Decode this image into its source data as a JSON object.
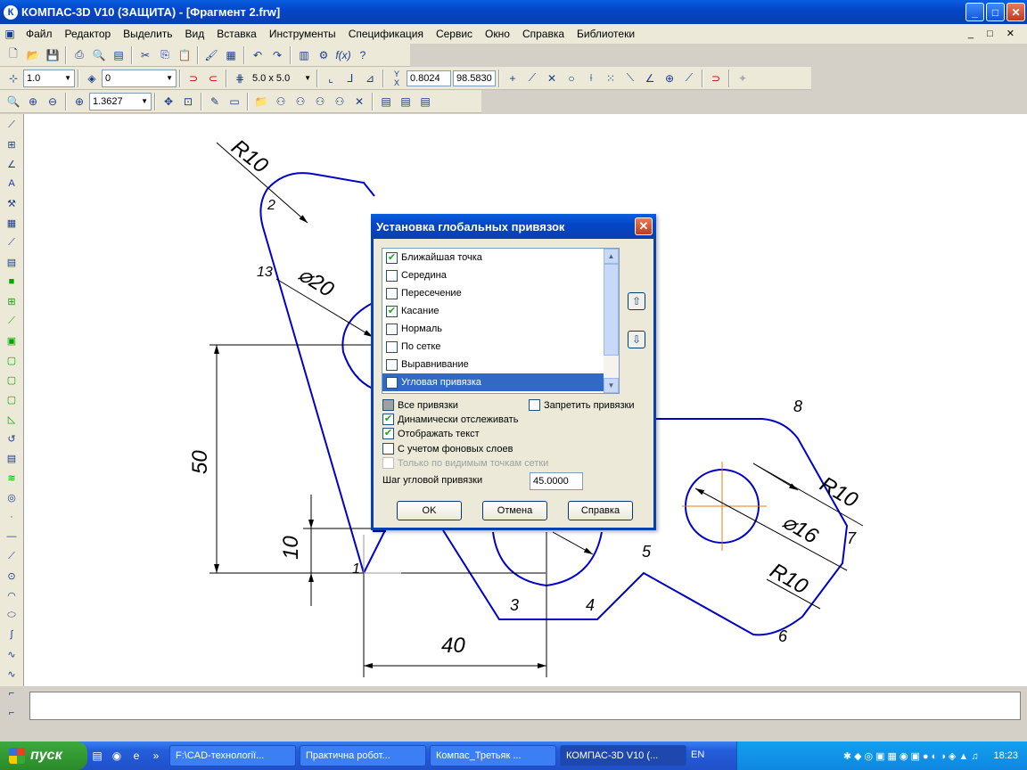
{
  "window": {
    "title": "КОМПАС-3D V10 (ЗАЩИТА) - [Фрагмент 2.frw]",
    "app_icon": "К",
    "minimize": "_",
    "maximize": "□",
    "close": "✕"
  },
  "menu": {
    "items": [
      "Файл",
      "Редактор",
      "Выделить",
      "Вид",
      "Вставка",
      "Инструменты",
      "Спецификация",
      "Сервис",
      "Окно",
      "Справка",
      "Библиотеки"
    ],
    "mdi_controls": "_ □ ✕"
  },
  "toolbar2": {
    "style_value": "1.0",
    "layer_value": "0",
    "grid_value": "5.0 x 5.0",
    "coord_x": "0.8024",
    "coord_y": "98.5830"
  },
  "toolbar3": {
    "zoom_value": "1.3627"
  },
  "drawing": {
    "labels": {
      "r10_top": "R10",
      "num2": "2",
      "num13": "13",
      "d20": "⌀20",
      "d50": "50",
      "d10": "10",
      "d40": "40",
      "num1": "1",
      "num3": "3",
      "num4": "4",
      "num5": "5",
      "num6": "6",
      "num7": "7",
      "num8": "8",
      "r10_right": "R10",
      "d16": "⌀16",
      "r10_bottom": "R10"
    },
    "line_color": "#0000c8",
    "dim_color": "#000000",
    "center_color": "#e08000"
  },
  "dialog": {
    "title": "Установка глобальных привязок",
    "list_items": [
      {
        "label": "Ближайшая точка",
        "checked": true
      },
      {
        "label": "Середина",
        "checked": false
      },
      {
        "label": "Пересечение",
        "checked": false
      },
      {
        "label": "Касание",
        "checked": true
      },
      {
        "label": "Нормаль",
        "checked": false
      },
      {
        "label": "По сетке",
        "checked": false
      },
      {
        "label": "Выравнивание",
        "checked": false
      },
      {
        "label": "Угловая привязка",
        "checked": false
      }
    ],
    "selected_index": 7,
    "options": {
      "all_snaps": "Все привязки",
      "forbid_snaps": "Запретить привязки",
      "dynamic_track": "Динамически отслеживать",
      "show_text": "Отображать текст",
      "bg_layers": "С учетом фоновых слоев",
      "visible_grid": "Только по видимым точкам сетки"
    },
    "angle_step_label": "Шаг угловой привязки",
    "angle_step_value": "45.0000",
    "ok": "OK",
    "cancel": "Отмена",
    "help": "Справка"
  },
  "taskbar": {
    "start": "пуск",
    "tasks": [
      "F:\\CAD-технології...",
      "Практична робот...",
      "Компас_Третьяк ...",
      "КОМПАС-3D V10 (..."
    ],
    "lang": "EN",
    "clock": "18:23"
  }
}
